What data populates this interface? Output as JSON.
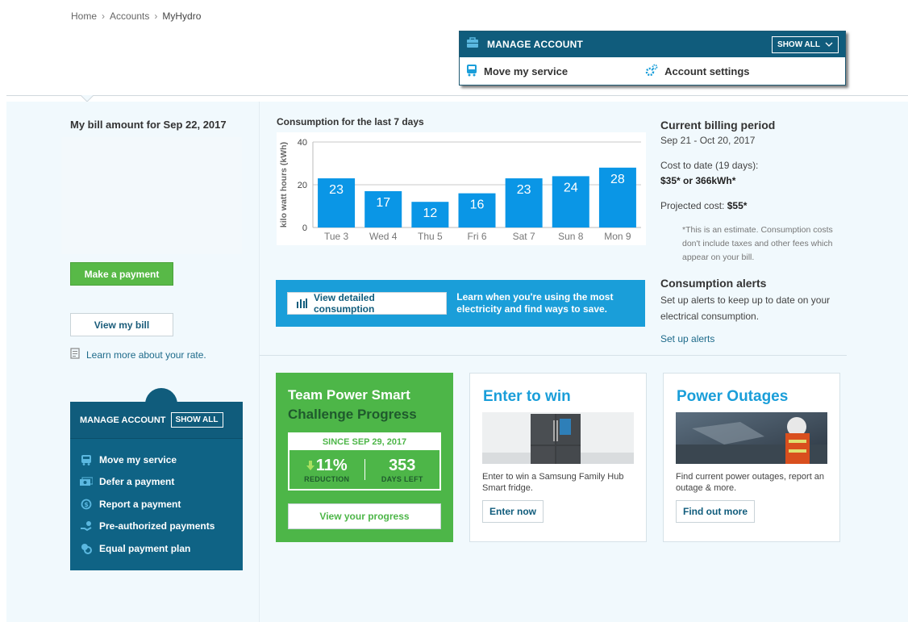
{
  "breadcrumb": {
    "home": "Home",
    "accounts": "Accounts",
    "current": "MyHydro",
    "sep": "›"
  },
  "top_manage": {
    "title": "MANAGE ACCOUNT",
    "show_all": "SHOW ALL",
    "links": [
      "Move my service",
      "Account settings"
    ]
  },
  "bill": {
    "title": "My bill amount for Sep 22, 2017",
    "make_payment": "Make a payment",
    "view_bill": "View my bill",
    "learn_rate": "Learn more about your rate."
  },
  "left_manage": {
    "title": "MANAGE ACCOUNT",
    "show_all": "SHOW ALL",
    "items": [
      "Move my service",
      "Defer a payment",
      "Report a payment",
      "Pre-authorized payments",
      "Equal payment plan"
    ]
  },
  "chart_data": {
    "type": "bar",
    "title": "Consumption for the last 7 days",
    "ylabel": "kilo watt hours (kWh)",
    "categories": [
      "Tue 3",
      "Wed 4",
      "Thu 5",
      "Fri 6",
      "Sat 7",
      "Sun 8",
      "Mon 9"
    ],
    "values": [
      23,
      17,
      12,
      16,
      23,
      24,
      28
    ],
    "yticks": [
      0,
      20,
      40
    ],
    "ylim": [
      0,
      40
    ],
    "grid": true,
    "bar_color": "#0a96e6"
  },
  "cta": {
    "button": "View detailed consumption",
    "text": "Learn when you're using the most electricity and find ways to save."
  },
  "billing_period": {
    "title": "Current billing period",
    "dates": "Sep 21 - Oct 20, 2017",
    "cost_to_date_label": "Cost to date (19 days):",
    "cost_to_date_value": "$35* or 366kWh*",
    "projected_label": "Projected cost:",
    "projected_value": "$55*",
    "note": "*This is an estimate. Consumption costs don't include taxes and other fees which appear on your bill."
  },
  "alerts": {
    "title": "Consumption alerts",
    "text": "Set up alerts to keep up to date on your electrical consumption.",
    "link": "Set up alerts"
  },
  "challenge": {
    "title1": "Team Power Smart",
    "title2": "Challenge Progress",
    "since": "SINCE SEP 29, 2017",
    "reduction_value": "11%",
    "reduction_label": "REDUCTION",
    "days_value": "353",
    "days_label": "DAYS LEFT",
    "button": "View your progress"
  },
  "enter_win": {
    "title": "Enter to win",
    "desc": "Enter to win a Samsung Family Hub Smart fridge.",
    "button": "Enter now"
  },
  "outages": {
    "title": "Power Outages",
    "desc": "Find current power outages, report an outage & more.",
    "button": "Find out more"
  },
  "colors": {
    "brand_dark": "#105c7c",
    "brand_blue": "#1a9ed9",
    "green": "#4db648"
  }
}
